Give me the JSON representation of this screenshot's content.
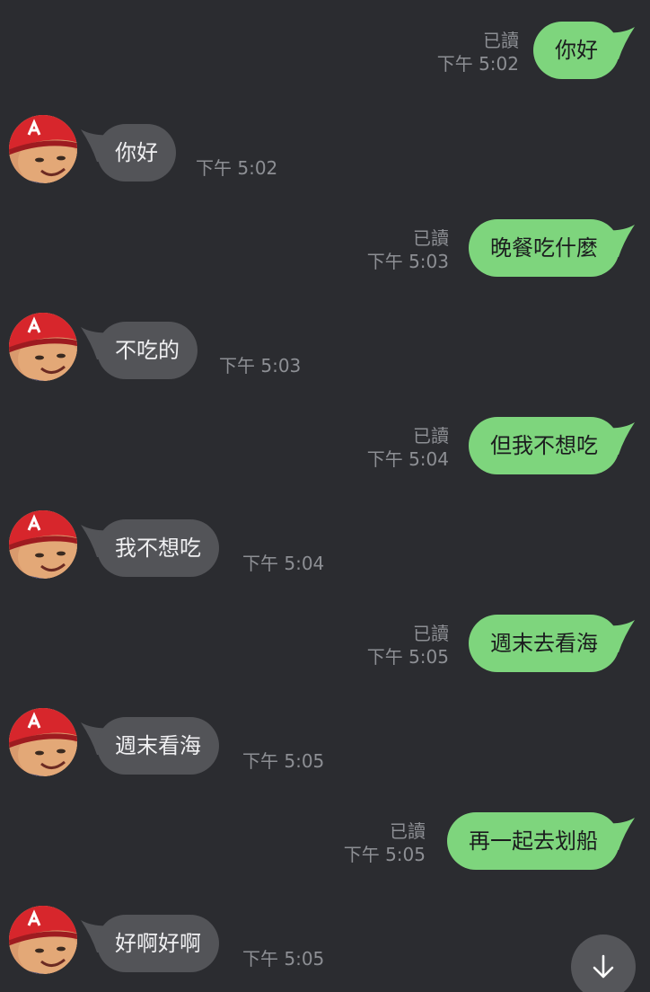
{
  "messages": [
    {
      "side": "out",
      "text": "你好",
      "read_label": "已讀",
      "time": "下午 5:02"
    },
    {
      "side": "in",
      "text": "你好",
      "time": "下午 5:02"
    },
    {
      "side": "out",
      "text": "晚餐吃什麼",
      "read_label": "已讀",
      "time": "下午 5:03"
    },
    {
      "side": "in",
      "text": "不吃的",
      "time": "下午 5:03"
    },
    {
      "side": "out",
      "text": "但我不想吃",
      "read_label": "已讀",
      "time": "下午 5:04"
    },
    {
      "side": "in",
      "text": "我不想吃",
      "time": "下午 5:04"
    },
    {
      "side": "out",
      "text": "週末去看海",
      "read_label": "已讀",
      "time": "下午 5:05"
    },
    {
      "side": "in",
      "text": "週末看海",
      "time": "下午 5:05"
    },
    {
      "side": "out",
      "text": "再一起去划船",
      "read_label": "已讀",
      "time": "下午 5:05"
    },
    {
      "side": "in",
      "text": "好啊好啊",
      "time": "下午 5:05"
    }
  ],
  "colors": {
    "background": "#2b2c30",
    "sent_bubble": "#7ed57d",
    "received_bubble": "#535458",
    "meta_text": "#8d8f94"
  },
  "scroll_button": {
    "icon": "arrow-down-icon"
  }
}
